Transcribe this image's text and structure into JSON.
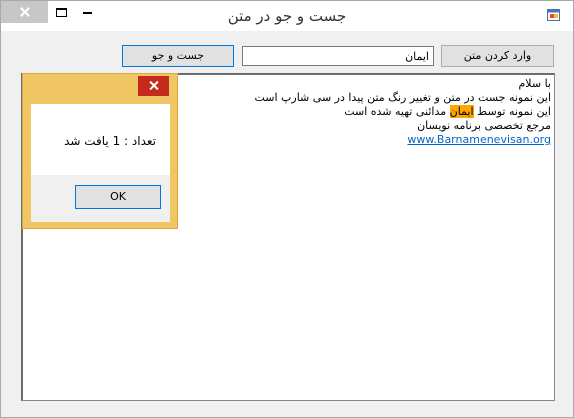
{
  "window": {
    "title": "جست و جو در متن",
    "icon": "app-icon"
  },
  "toolbar": {
    "enter_text_button": "وارد کردن متن",
    "search_button": "جست و جو",
    "search_input_value": "ایمان"
  },
  "text_area": {
    "line1": "با سلام",
    "line2": "این نمونه جست در متن و تغییر رنگ متن پیدا در سی شارپ است",
    "line3_before": "این نمونه توسط ",
    "line3_highlight": "ایمان",
    "line3_after": " مدائنی تهیه شده است",
    "line4": "مرجع تخصصی برنامه نویسان",
    "link": "www.Barnamenevisan.org",
    "highlight_color": "#ffa500"
  },
  "message_box": {
    "text": "تعداد : 1 یافت شد",
    "ok_button": "OK",
    "frame_color": "#f0c764",
    "close_color": "#c42b1c"
  }
}
